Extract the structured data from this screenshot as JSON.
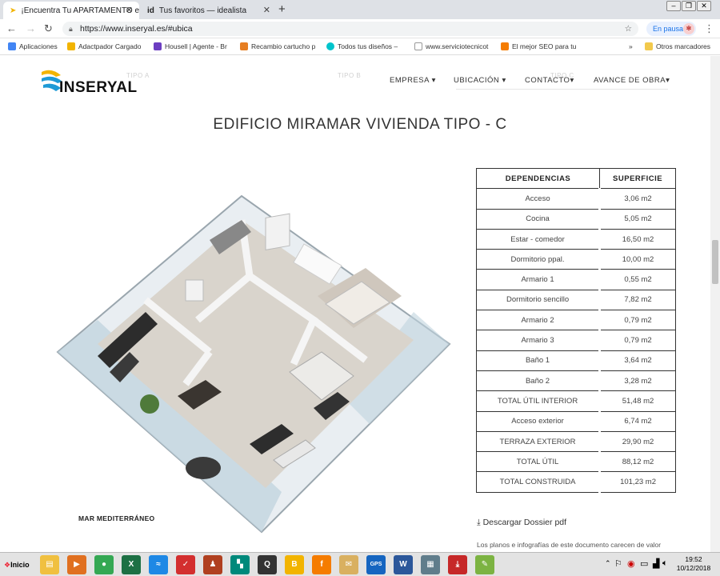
{
  "browser": {
    "tabs": [
      {
        "label": "¡Encuentra Tu APARTAMENTO e",
        "active": true,
        "icon": "inseryal-favicon"
      },
      {
        "label": "Tus favoritos — idealista",
        "active": false,
        "icon": "idealista-favicon"
      }
    ],
    "url": "https://www.inseryal.es/#ubica",
    "pause_label": "En pausa",
    "bookmarks": [
      {
        "label": "Aplicaciones",
        "icon_color": "#4285f4"
      },
      {
        "label": "Adactpador Cargado",
        "icon_color": "#f2b400"
      },
      {
        "label": "Housell | Agente - Br",
        "icon_color": "#6c3ec1"
      },
      {
        "label": "Recambio cartucho p",
        "icon_color": "#e67e22"
      },
      {
        "label": "Todos tus diseños – ",
        "icon_color": "#00c4cc"
      },
      {
        "label": "www.serviciotecnicot",
        "icon_color": "#999999"
      },
      {
        "label": "El mejor SEO para tu",
        "icon_color": "#f57c00"
      }
    ],
    "bookmarks_more": "»",
    "other_bookmarks": "Otros marcadores"
  },
  "site": {
    "logo_text": "INSERYAL",
    "nav": [
      "EMPRESA",
      "UBICACIÓN",
      "CONTACTO",
      "AVANCE DE OBRA"
    ],
    "ghost_tabs": [
      "TIPO A",
      "TIPO B",
      "TIPO C"
    ],
    "title": "EDIFICIO MIRAMAR VIVIENDA TIPO - C",
    "plan_caption": "MAR MEDITERRÁNEO",
    "table": {
      "headers": [
        "DEPENDENCIAS",
        "SUPERFICIE"
      ],
      "rows": [
        [
          "Acceso",
          "3,06 m2"
        ],
        [
          "Cocina",
          "5,05 m2"
        ],
        [
          "Estar - comedor",
          "16,50 m2"
        ],
        [
          "Dormitorio ppal.",
          "10,00 m2"
        ],
        [
          "Armario 1",
          "0,55 m2"
        ],
        [
          "Dormitorio sencillo",
          "7,82 m2"
        ],
        [
          "Armario 2",
          "0,79 m2"
        ],
        [
          "Armario 3",
          "0,79 m2"
        ],
        [
          "Baño 1",
          "3,64 m2"
        ],
        [
          "Baño 2",
          "3,28 m2"
        ],
        [
          "TOTAL ÚTIL INTERIOR",
          "51,48 m2"
        ],
        [
          "Acceso exterior",
          "6,74 m2"
        ],
        [
          "TERRAZA EXTERIOR",
          "29,90 m2"
        ],
        [
          "TOTAL ÚTIL",
          "88,12 m2"
        ],
        [
          "TOTAL CONSTRUIDA",
          "101,23 m2"
        ]
      ]
    },
    "download_label": "Descargar Dossier pdf",
    "note": "Los planos e infografías de este documento carecen de valor"
  },
  "taskbar": {
    "start_label": "Inicio",
    "time": "19:52",
    "date": "10/12/2018",
    "icons": [
      {
        "name": "folder",
        "color": "#f0c040",
        "glyph": "▤"
      },
      {
        "name": "media",
        "color": "#e07020",
        "glyph": "▶"
      },
      {
        "name": "chrome",
        "color": "#34a853",
        "glyph": "●"
      },
      {
        "name": "excel",
        "color": "#1d7044",
        "glyph": "X"
      },
      {
        "name": "app-blue",
        "color": "#1e88e5",
        "glyph": "≈"
      },
      {
        "name": "app-red",
        "color": "#d32f2f",
        "glyph": "✓"
      },
      {
        "name": "app-person",
        "color": "#b04020",
        "glyph": "♟"
      },
      {
        "name": "app-green",
        "color": "#00897b",
        "glyph": "▚"
      },
      {
        "name": "app-search",
        "color": "#333333",
        "glyph": "Q"
      },
      {
        "name": "app-b",
        "color": "#f2b400",
        "glyph": "B"
      },
      {
        "name": "app-orange",
        "color": "#f57c00",
        "glyph": "f"
      },
      {
        "name": "mail",
        "color": "#d9b060",
        "glyph": "✉"
      },
      {
        "name": "gps",
        "color": "#1565c0",
        "glyph": "GPS"
      },
      {
        "name": "word",
        "color": "#2b579a",
        "glyph": "W"
      },
      {
        "name": "app-doc",
        "color": "#607d8b",
        "glyph": "▦"
      },
      {
        "name": "pdf",
        "color": "#c62828",
        "glyph": "⤓"
      },
      {
        "name": "app-pen",
        "color": "#7cb342",
        "glyph": "✎"
      }
    ]
  }
}
